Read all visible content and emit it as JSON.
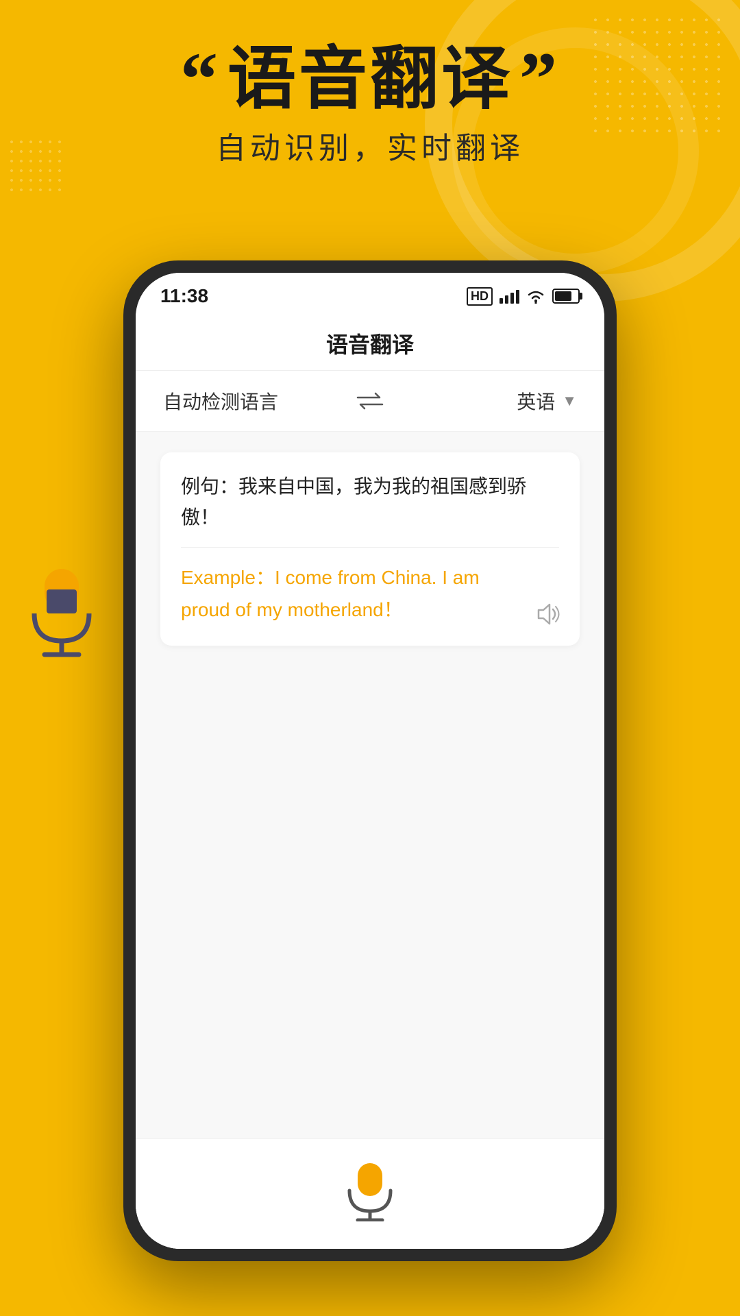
{
  "background": {
    "color": "#F5B800"
  },
  "header": {
    "quote_open": "“",
    "quote_close": "”",
    "main_title": "语音翻译",
    "subtitle": "自动识别，实时翻译"
  },
  "status_bar": {
    "time": "11:38",
    "signal_label": "HD",
    "battery_percent": "75"
  },
  "app": {
    "title": "语音翻译",
    "source_lang": "自动检测语言",
    "swap_icon": "⇌",
    "target_lang": "英语",
    "source_text": "例句：我来自中国，我为我的祖国感到骄傲！",
    "translated_text": "Example：I come from China. I am proud of my motherland！"
  }
}
